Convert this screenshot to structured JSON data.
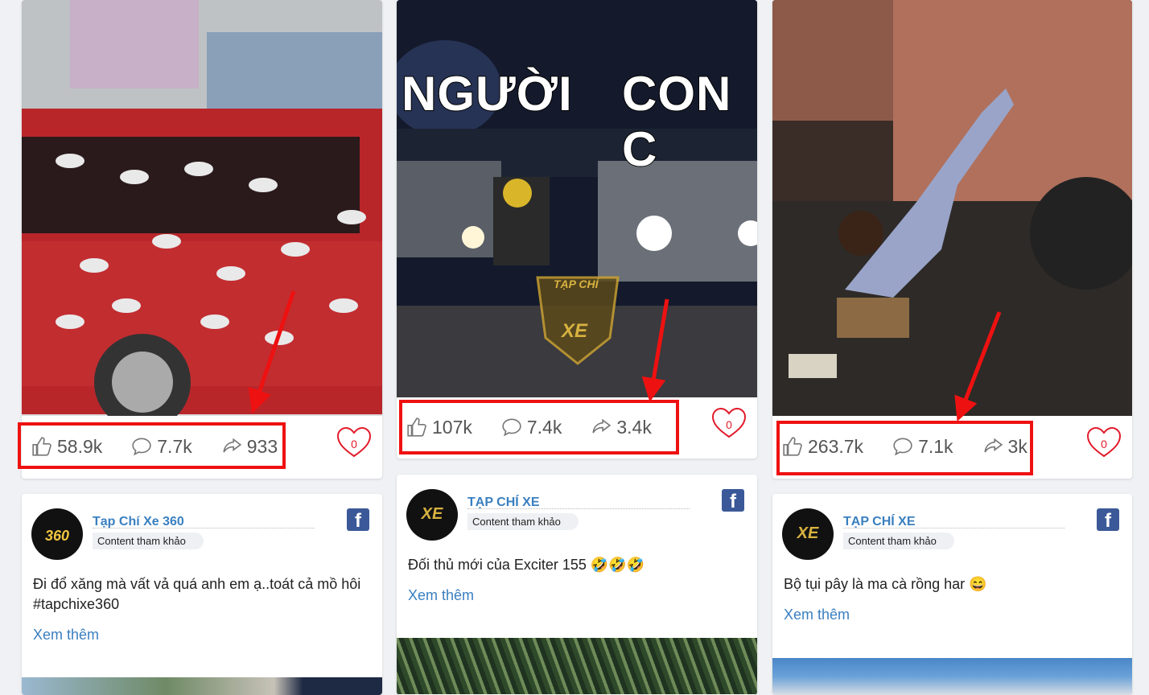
{
  "cards": [
    {
      "likes": "58.9k",
      "comments": "7.7k",
      "shares": "933",
      "hearts": "0"
    },
    {
      "likes": "107k",
      "comments": "7.4k",
      "shares": "3.4k",
      "hearts": "0",
      "caption_left": "NGƯỜI",
      "caption_right": "CON C",
      "badge_top": "TẠP CHÍ",
      "badge_bottom": "XE"
    },
    {
      "likes": "263.7k",
      "comments": "7.1k",
      "shares": "3k",
      "hearts": "0"
    }
  ],
  "posts": [
    {
      "page": "Tạp Chí Xe 360",
      "tag": "Content tham khảo",
      "text": "Đi đổ xăng mà vất vả quá anh em ạ..toát cả mồ hôi #tapchixe360",
      "more": "Xem thêm",
      "avatar_text": "360"
    },
    {
      "page": "TẠP CHÍ XE",
      "tag": "Content tham khảo",
      "text": "Đối thủ mới của Exciter 155 🤣🤣🤣",
      "more": "Xem thêm",
      "avatar_text": "XE"
    },
    {
      "page": "TẠP CHÍ XE",
      "tag": "Content tham khảo",
      "text": "Bộ tụi pây là ma cà rồng har 😄",
      "more": "Xem thêm",
      "avatar_text": "XE"
    }
  ],
  "icons": {
    "like": "thumbs-up-icon",
    "comment": "comment-icon",
    "share": "share-icon",
    "heart": "heart-icon",
    "facebook": "facebook-icon"
  },
  "colors": {
    "highlight": "#ee1111",
    "link": "#3a7fc0",
    "heart": "#e21a2a",
    "facebook": "#3b5998"
  }
}
